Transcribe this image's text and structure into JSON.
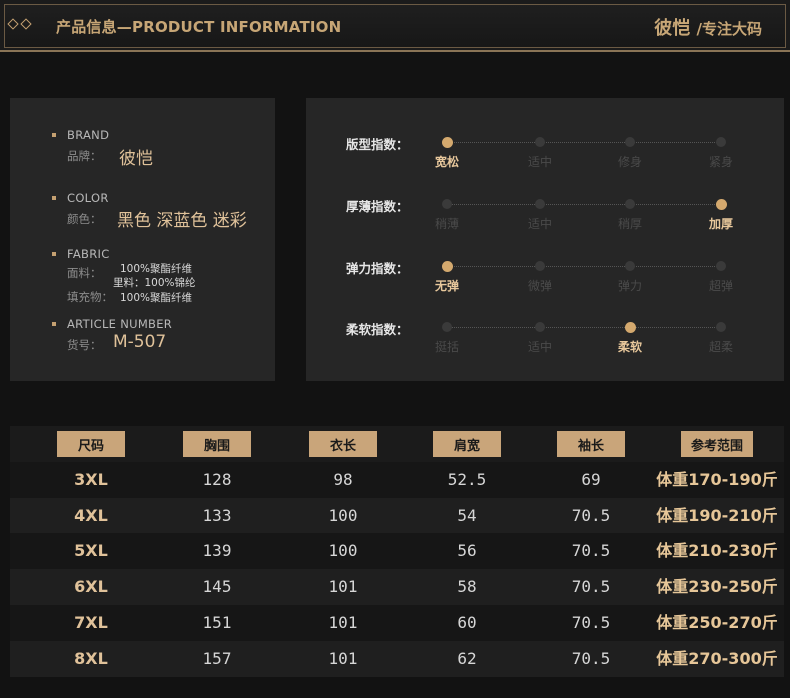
{
  "header": {
    "title": "产品信息—PRODUCT INFORMATION",
    "brand_right": "彼恺",
    "slogan_right": "/专注大码"
  },
  "info": {
    "brand": {
      "label_en": "BRAND",
      "label_cn": "品牌：",
      "value": "彼恺"
    },
    "color": {
      "label_en": "COLOR",
      "label_cn": "颜色：",
      "value": "黑色 深蓝色 迷彩"
    },
    "fabric": {
      "label_en": "FABRIC",
      "lines": [
        {
          "label": "面料：",
          "value": "100%聚酯纤维"
        },
        {
          "label": "",
          "value": "里料：100%锦纶"
        },
        {
          "label": "填充物：",
          "value": "100%聚酯纤维"
        }
      ]
    },
    "article": {
      "label_en": "ARTICLE NUMBER",
      "label_cn": "货号：",
      "value": "M-507"
    }
  },
  "indices": [
    {
      "label": "版型指数：",
      "options": [
        "宽松",
        "适中",
        "修身",
        "紧身"
      ],
      "selected": 0
    },
    {
      "label": "厚薄指数：",
      "options": [
        "稍薄",
        "适中",
        "稍厚",
        "加厚"
      ],
      "selected": 3
    },
    {
      "label": "弹力指数：",
      "options": [
        "无弹",
        "微弹",
        "弹力",
        "超弹"
      ],
      "selected": 0
    },
    {
      "label": "柔软指数：",
      "options": [
        "挺括",
        "适中",
        "柔软",
        "超柔"
      ],
      "selected": 2
    }
  ],
  "size_table": {
    "headers": [
      "尺码",
      "胸围",
      "衣长",
      "肩宽",
      "袖长",
      "参考范围"
    ],
    "rows": [
      [
        "3XL",
        "128",
        "98",
        "52.5",
        "69",
        "体重170-190斤"
      ],
      [
        "4XL",
        "133",
        "100",
        "54",
        "70.5",
        "体重190-210斤"
      ],
      [
        "5XL",
        "139",
        "100",
        "56",
        "70.5",
        "体重210-230斤"
      ],
      [
        "6XL",
        "145",
        "101",
        "58",
        "70.5",
        "体重230-250斤"
      ],
      [
        "7XL",
        "151",
        "101",
        "60",
        "70.5",
        "体重250-270斤"
      ],
      [
        "8XL",
        "157",
        "101",
        "62",
        "70.5",
        "体重270-300斤"
      ]
    ]
  },
  "colors": {
    "accent": "#c9a57a",
    "gold_text": "#e0c29a",
    "background": "#121212",
    "panel": "#262626"
  }
}
